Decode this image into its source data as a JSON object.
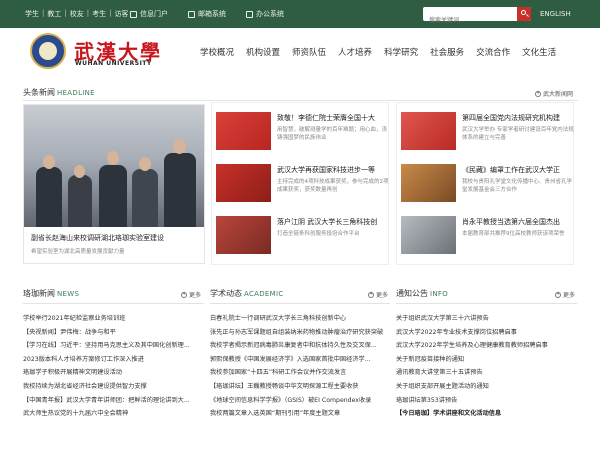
{
  "topbar": {
    "quick_links": [
      "学生",
      "教工",
      "校友",
      "考生",
      "访客"
    ],
    "links": [
      {
        "label": "信息门户",
        "icon": "portal-icon"
      },
      {
        "label": "邮箱系统",
        "icon": "mail-icon"
      },
      {
        "label": "办公系统",
        "icon": "office-icon"
      }
    ],
    "search_placeholder": "搜索关键词...",
    "search_icon": "search-icon",
    "language": "ENGLISH"
  },
  "header": {
    "brand_cn": "武漢大學",
    "brand_en": "WUHAN UNIVERSITY",
    "nav": [
      "学校概况",
      "机构设置",
      "师资队伍",
      "人才培养",
      "科学研究",
      "社会服务",
      "交流合作",
      "文化生活"
    ]
  },
  "headline": {
    "title": "头条新闻",
    "title_en": "HEADLINE",
    "more_label": "武大新闻网",
    "feature": {
      "caption": "副省长赵海山来校调研湖北珞珈实验室建设",
      "sub": "希望实验室为湖北高质量发展贡献力量"
    },
    "cards": [
      {
        "title": "致敬！李德仁院士荣膺全国十大",
        "desc": "用智慧，破解测量学的百年难题；用心血，浇铸强国梦的民族伟业"
      },
      {
        "title": "武汉大学再获国家科技进步一等",
        "desc": "主持完成的4项科技成果获奖，参与完成的2项成果获奖，获奖数量再创"
      },
      {
        "title": "落户江阴 武汉大学长三角科技创",
        "desc": "打造全链条科创服务投培合作平台"
      },
      {
        "title": "第四届全国党内法规研究机构建",
        "desc": "武汉大学举办 专家学者研讨建设百年党内法规体系的建立与完善"
      },
      {
        "title": "《民藏》编罩工作在武汉大学正",
        "desc": "我校与贵阳孔学堂文化传播中心、贵州省孔学堂发展基金会三方合作"
      },
      {
        "title": "肖永平教授当选第六届全国杰出",
        "desc": "本届教育部共推荐9位高校教师获该项荣誉"
      }
    ]
  },
  "news": {
    "title": "珞珈新闻",
    "title_en": "NEWS",
    "more_label": "更多",
    "items": [
      "学校举行2021年纪检监察业务培训班",
      "【央视新闻】尹伟梅：战争与和平",
      "【学习在线】习近平：坚持用马克思主义及其中国化创新理...",
      "2023版本科人才培养方案修订工作深入推进",
      "珞珈学子积极开展精神文明建设活动",
      "我校持续为湖北省经济社会建设提供智力支撑",
      "【中国青年报】武汉大学青年讲师团：把鲜活的理论讲到大...",
      "武大师生热议党的十九届六中全会精神"
    ]
  },
  "academic": {
    "title": "学术动态",
    "title_en": "ACADEMIC",
    "more_label": "更多",
    "items": [
      "白春礼院士一行调研武汉大学长三角科技创新中心",
      "张先正与孙志军课题组自组装纳米药物推动肿瘤治疗研究获突破",
      "我校学者揭示新冠病毒肺炎康复者中和抗体持久性及交叉保...",
      "郭熙保教授《中国发展经济学》入选国家首批中国经济学...",
      "我校参加国家“十四五”科研工作会议并作交流发言",
      "【珞珈讲坛】王巍教授畅谈中华文明探源工程主要收获",
      "《地球空间信息科学学报》（GSIS）被EI Compendex收录",
      "我校两篇文章入选英国“期刊引用”年度主题文章"
    ]
  },
  "notice": {
    "title": "通知公告",
    "title_en": "INFO",
    "more_label": "更多",
    "items": [
      {
        "text": "关于组织武汉大学第三十六讲预告",
        "bold": false
      },
      {
        "text": "武汉大学2022年专业技术支撑岗位招聘启事",
        "bold": false
      },
      {
        "text": "武汉大学2022年学生培养及心理健康教育教师招聘启事",
        "bold": false
      },
      {
        "text": "关于新冠疫苗接种的通知",
        "bold": false
      },
      {
        "text": "通讯教育大讲堂第三十五讲预告",
        "bold": false
      },
      {
        "text": "关于组织支部开展主题活动的通知",
        "bold": false
      },
      {
        "text": "珞珈讲坛第353讲预告",
        "bold": false
      },
      {
        "text": "【今日珞珈】学术讲座和文化活动信息",
        "bold": true
      }
    ]
  }
}
